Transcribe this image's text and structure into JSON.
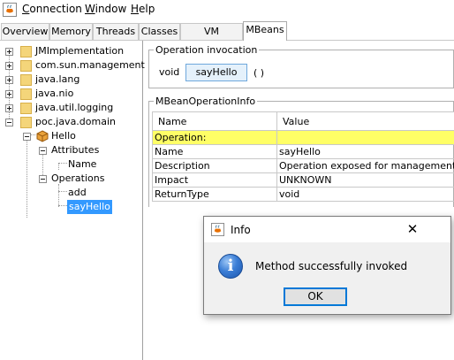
{
  "menu": [
    {
      "mnemonic": "C",
      "rest": "onnection"
    },
    {
      "mnemonic": "W",
      "rest": "indow"
    },
    {
      "mnemonic": "H",
      "rest": "elp"
    }
  ],
  "tabs": [
    "Overview",
    "Memory",
    "Threads",
    "Classes",
    "VM Summary",
    "MBeans"
  ],
  "active_tab": "MBeans",
  "tree": {
    "top_nodes": [
      "JMImplementation",
      "com.sun.management",
      "java.lang",
      "java.nio",
      "java.util.logging",
      "poc.java.domain"
    ],
    "hello": "Hello",
    "attributes": "Attributes",
    "attr_name": "Name",
    "operations": "Operations",
    "op_add": "add",
    "op_sayhello": "sayHello"
  },
  "invocation": {
    "title": "Operation invocation",
    "return_type": "void",
    "button_label": "sayHello",
    "params": "( )"
  },
  "opinfo": {
    "title": "MBeanOperationInfo",
    "headers": [
      "Name",
      "Value"
    ],
    "section": "Operation:",
    "rows": [
      [
        "Name",
        "sayHello"
      ],
      [
        "Description",
        "Operation exposed for management"
      ],
      [
        "Impact",
        "UNKNOWN"
      ],
      [
        "ReturnType",
        "void"
      ]
    ]
  },
  "dialog": {
    "title": "Info",
    "message": "Method successfully invoked",
    "ok_label": "OK",
    "close_glyph": "✕"
  },
  "colors": {
    "selection": "#3399ff",
    "highlight_row": "#ffff66",
    "info_icon": "#3b7ed6"
  }
}
